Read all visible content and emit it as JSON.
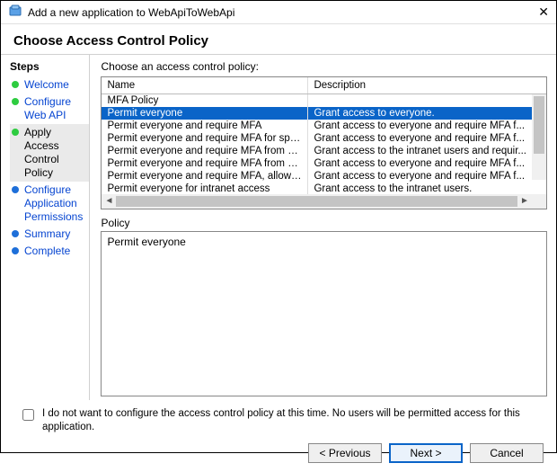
{
  "window": {
    "title": "Add a new application to WebApiToWebApi"
  },
  "heading": "Choose Access Control Policy",
  "steps": {
    "heading": "Steps",
    "items": [
      {
        "label": "Welcome",
        "status": "green",
        "current": false
      },
      {
        "label": "Configure Web API",
        "status": "green",
        "current": false
      },
      {
        "label": "Apply Access Control Policy",
        "status": "green",
        "current": true
      },
      {
        "label": "Configure Application Permissions",
        "status": "blue",
        "current": false
      },
      {
        "label": "Summary",
        "status": "blue",
        "current": false
      },
      {
        "label": "Complete",
        "status": "blue",
        "current": false
      }
    ]
  },
  "policy_picker": {
    "prompt": "Choose an access control policy:",
    "columns": {
      "name": "Name",
      "description": "Description"
    },
    "rows": [
      {
        "name": "MFA Policy",
        "description": ""
      },
      {
        "name": "Permit everyone",
        "description": "Grant access to everyone.",
        "selected": true
      },
      {
        "name": "Permit everyone and require MFA",
        "description": "Grant access to everyone and require MFA f..."
      },
      {
        "name": "Permit everyone and require MFA for specific group",
        "description": "Grant access to everyone and require MFA f..."
      },
      {
        "name": "Permit everyone and require MFA from extranet access",
        "description": "Grant access to the intranet users and requir..."
      },
      {
        "name": "Permit everyone and require MFA from unauthenticated ...",
        "description": "Grant access to everyone and require MFA f..."
      },
      {
        "name": "Permit everyone and require MFA, allow automatic devi...",
        "description": "Grant access to everyone and require MFA f..."
      },
      {
        "name": "Permit everyone for intranet access",
        "description": "Grant access to the intranet users."
      }
    ]
  },
  "policy_detail": {
    "label": "Policy",
    "text": "Permit everyone"
  },
  "skip": {
    "label": "I do not want to configure the access control policy at this time.  No users will be permitted access for this application.",
    "checked": false
  },
  "buttons": {
    "previous": "< Previous",
    "next": "Next >",
    "cancel": "Cancel"
  }
}
